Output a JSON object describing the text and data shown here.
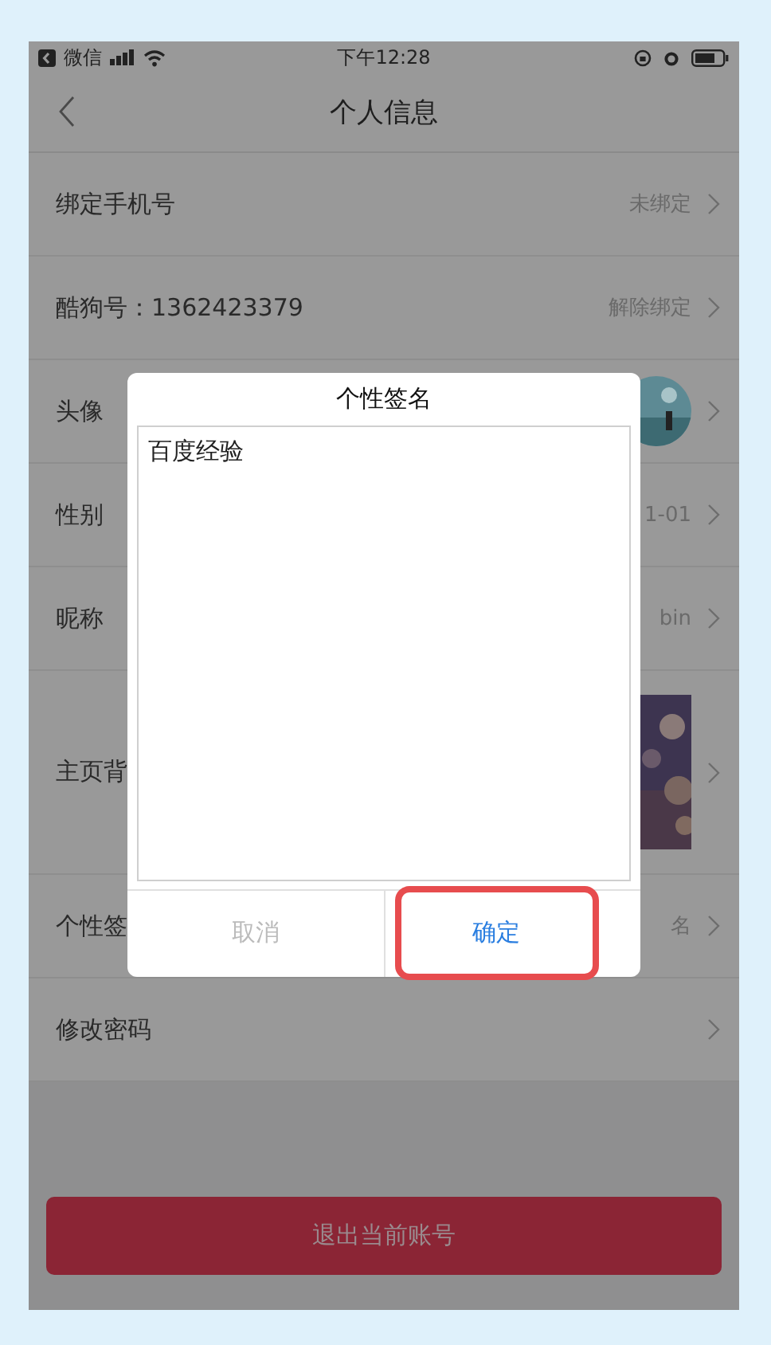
{
  "status_bar": {
    "back_app": "微信",
    "time": "下午12:28"
  },
  "nav": {
    "title": "个人信息"
  },
  "rows": [
    {
      "kind": "text",
      "label": "绑定手机号",
      "value": "未绑定"
    },
    {
      "kind": "text",
      "label": "酷狗号：1362423379",
      "value": "解除绑定"
    },
    {
      "kind": "avatar",
      "label": "头像"
    },
    {
      "kind": "text",
      "label": "性别",
      "value": "1-01"
    },
    {
      "kind": "text",
      "label": "昵称",
      "value": "bin"
    },
    {
      "kind": "picture",
      "label": "主页背"
    },
    {
      "kind": "text",
      "label": "个性签",
      "value": "名"
    },
    {
      "kind": "text",
      "label": "修改密码"
    }
  ],
  "logout_button": "退出当前账号",
  "dialog": {
    "title": "个性签名",
    "value": "百度经验",
    "buttons": [
      {
        "label": "取消",
        "kind": "cancel",
        "highlighted": false
      },
      {
        "label": "确定",
        "kind": "confirm",
        "highlighted": true
      }
    ]
  }
}
